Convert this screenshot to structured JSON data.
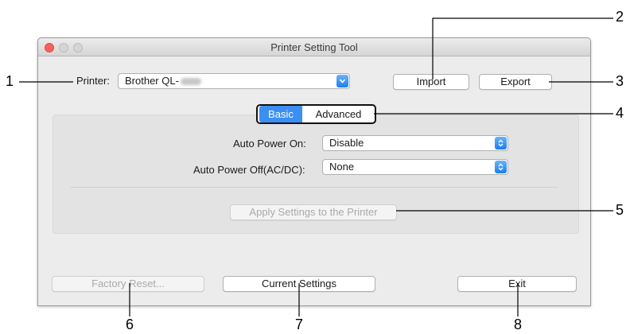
{
  "window": {
    "title": "Printer Setting Tool"
  },
  "printer": {
    "label": "Printer:",
    "value": "Brother QL-",
    "import_label": "Import",
    "export_label": "Export"
  },
  "tabs": [
    {
      "label": "Basic",
      "active": true
    },
    {
      "label": "Advanced",
      "active": false
    }
  ],
  "settings": {
    "auto_power_on_label": "Auto Power On:",
    "auto_power_on_value": "Disable",
    "auto_power_off_label": "Auto Power Off(AC/DC):",
    "auto_power_off_value": "None",
    "apply_label": "Apply Settings to the Printer"
  },
  "footer": {
    "factory_reset_label": "Factory Reset...",
    "current_settings_label": "Current Settings",
    "exit_label": "Exit"
  },
  "callouts": [
    "1",
    "2",
    "3",
    "4",
    "5",
    "6",
    "7",
    "8"
  ],
  "colors": {
    "accent": "#3b8ff3",
    "close_button": "#fc605c",
    "window_bg": "#ececec"
  }
}
